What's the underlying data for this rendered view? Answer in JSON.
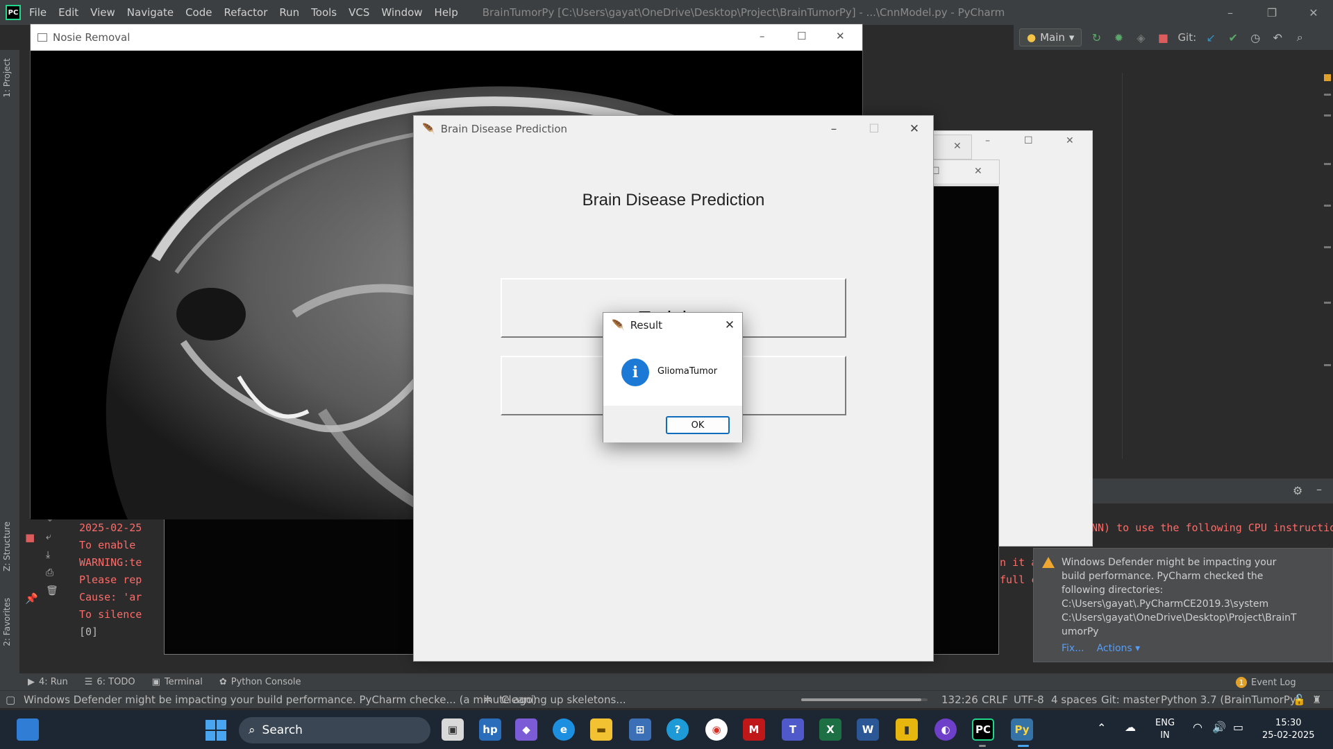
{
  "ide": {
    "menu": [
      "File",
      "Edit",
      "View",
      "Navigate",
      "Code",
      "Refactor",
      "Run",
      "Tools",
      "VCS",
      "Window",
      "Help"
    ],
    "title": "BrainTumorPy [C:\\Users\\gayat\\OneDrive\\Desktop\\Project\\BrainTumorPy] - ...\\CnnModel.py - PyCharm",
    "run_config": "Main",
    "git_label": "Git:",
    "left_tabs": {
      "project": "1: Project",
      "structure": "Z: Structure",
      "favorites": "2: Favorites"
    }
  },
  "console": {
    "lines_left": [
      "2025-02-25",
      "To enable ",
      "WARNING:te",
      "Please rep",
      "Cause: 'ar",
      "To silence",
      "[0]"
    ],
    "line_right_1": "NN) to use the following CPU instructio",
    "line_right_2": "n it a",
    "line_right_3": "full c"
  },
  "notification": {
    "text": "Windows Defender might be impacting your\nbuild performance. PyCharm checked the\nfollowing directories:\nC:\\Users\\gayat\\.PyCharmCE2019.3\\system\nC:\\Users\\gayat\\OneDrive\\Desktop\\Project\\BrainT\numorPy",
    "fix": "Fix...",
    "actions": "Actions ▾"
  },
  "bottom_tabs": {
    "run": "4: Run",
    "todo": "6: TODO",
    "terminal": "Terminal",
    "python_console": "Python Console",
    "event_log": "Event Log",
    "event_count": "1"
  },
  "status": {
    "message": "Windows Defender might be impacting your build performance. PyCharm checke... (a minute ago)",
    "task": "Cleaning up skeletons...",
    "progress": 0.95,
    "position": "132:26",
    "line_sep": "CRLF",
    "encoding": "UTF-8",
    "indent": "4 spaces",
    "branch": "Git: master",
    "interpreter": "Python 3.7 (BrainTumorPy)"
  },
  "noise_window": {
    "title": "Nosie Removal"
  },
  "bdp_window": {
    "title": "Brain Disease Prediction",
    "heading": "Brain Disease Prediction",
    "button_training": "Training"
  },
  "result_dialog": {
    "title": "Result",
    "message": "GliomaTumor",
    "ok": "OK"
  },
  "taskbar": {
    "search": "Search",
    "lang": "ENG",
    "region": "IN",
    "time": "15:30",
    "date": "25-02-2025"
  }
}
